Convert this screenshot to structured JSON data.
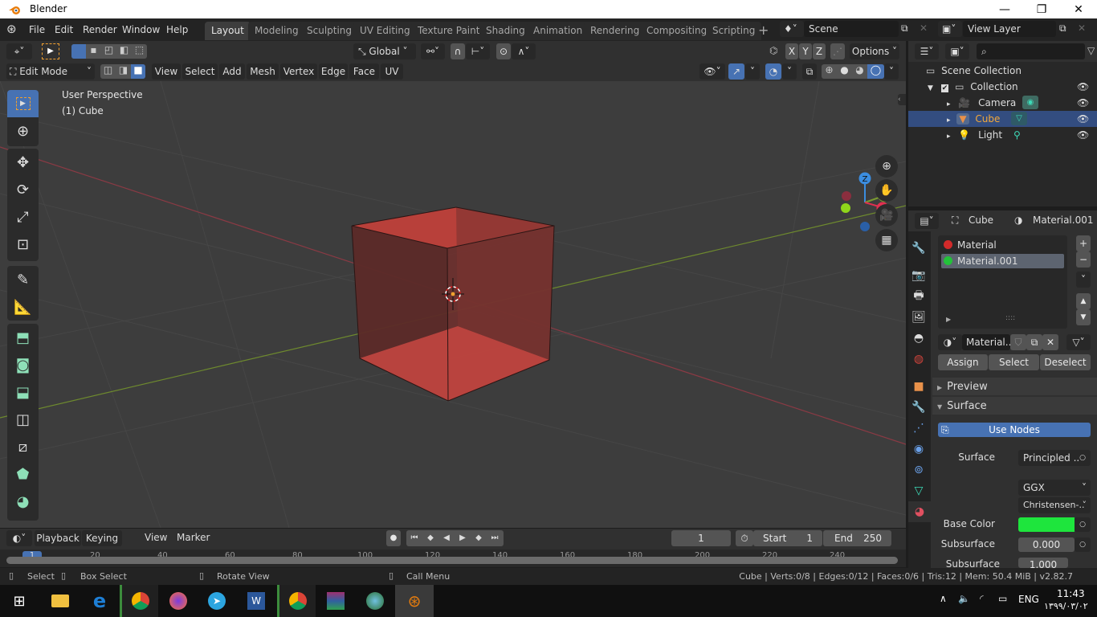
{
  "window": {
    "title": "Blender",
    "controls": {
      "minimize": "—",
      "maximize": "❐",
      "close": "✕"
    }
  },
  "menu": [
    "File",
    "Edit",
    "Render",
    "Window",
    "Help"
  ],
  "workspaces": [
    {
      "label": "Layout",
      "active": true
    },
    {
      "label": "Modeling"
    },
    {
      "label": "Sculpting"
    },
    {
      "label": "UV Editing"
    },
    {
      "label": "Texture Paint"
    },
    {
      "label": "Shading"
    },
    {
      "label": "Animation"
    },
    {
      "label": "Rendering"
    },
    {
      "label": "Compositing"
    },
    {
      "label": "Scripting"
    }
  ],
  "add_workspace": "+",
  "scene": {
    "name": "Scene",
    "view_layer": "View Layer"
  },
  "tool_header": {
    "orientation": "Global",
    "axes": [
      "X",
      "Y",
      "Z"
    ],
    "options": "Options"
  },
  "viewport_header": {
    "mode": "Edit Mode",
    "menus": [
      "View",
      "Select",
      "Add",
      "Mesh",
      "Vertex",
      "Edge",
      "Face",
      "UV"
    ]
  },
  "viewport": {
    "view_name": "User Perspective",
    "object_label": "(1) Cube",
    "gizmo": {
      "z": "Z",
      "y": "Y",
      "x": "X"
    }
  },
  "toolbar": [
    "select-box",
    "cursor",
    "move",
    "rotate",
    "scale",
    "transform",
    "annotate",
    "measure",
    "extrude-region",
    "inset-faces",
    "bevel",
    "loop-cut",
    "knife",
    "poly-build",
    "spin"
  ],
  "outliner": {
    "search_placeholder": "",
    "scene_collection": "Scene Collection",
    "items": [
      {
        "label": "Collection",
        "type": "collection"
      },
      {
        "label": "Camera",
        "type": "camera"
      },
      {
        "label": "Cube",
        "type": "mesh",
        "selected": true
      },
      {
        "label": "Light",
        "type": "light"
      }
    ]
  },
  "properties": {
    "breadcrumb": {
      "object": "Cube",
      "material": "Material.001"
    },
    "material_slots": [
      {
        "label": "Material",
        "color": "#d22a2a"
      },
      {
        "label": "Material.001",
        "color": "#23c23a",
        "selected": true
      }
    ],
    "material_name": "Material..",
    "buttons": {
      "assign": "Assign",
      "select": "Select",
      "deselect": "Deselect"
    },
    "panels": {
      "preview": "Preview",
      "surface": "Surface"
    },
    "use_nodes": "Use Nodes",
    "surface_label": "Surface",
    "surface_value": "Principled ..",
    "distribution": "GGX",
    "subsurface_method": "Christensen-..",
    "base_color_label": "Base Color",
    "base_color": "#1ee53d",
    "subsurface_label": "Subsurface",
    "subsurface_value": "0.000",
    "subsurface_r_label": "Subsurface R..",
    "subsurface_r_value": "1.000"
  },
  "timeline": {
    "menus": [
      "Playback",
      "Keying",
      "View",
      "Marker"
    ],
    "current_frame": "1",
    "start_label": "Start",
    "start": "1",
    "end_label": "End",
    "end": "250",
    "ticks": [
      "1",
      "20",
      "40",
      "60",
      "80",
      "100",
      "120",
      "140",
      "160",
      "180",
      "200",
      "220",
      "240"
    ]
  },
  "statusbar": {
    "select": "Select",
    "box_select": "Box Select",
    "rotate_view": "Rotate View",
    "call_menu": "Call Menu",
    "stats": "Cube | Verts:0/8 | Edges:0/12 | Faces:0/6 | Tris:12 | Mem: 50.4 MiB | v2.82.7"
  },
  "taskbar": {
    "apps": [
      "start",
      "file-explorer",
      "edge",
      "chrome-profile-a",
      "firefox",
      "telegram",
      "word",
      "chrome-profile-b",
      "winrar",
      "internet-download-manager",
      "blender"
    ],
    "tray": {
      "language": "ENG",
      "time": "11:43",
      "date": "۱۳۹۹/۰۳/۰۲"
    }
  }
}
